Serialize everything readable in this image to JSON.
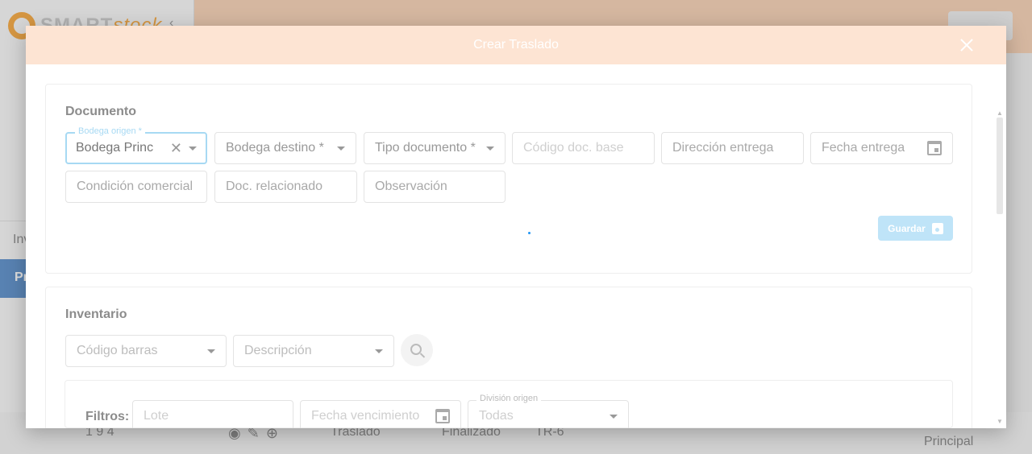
{
  "background": {
    "logo_text_a": "SMART",
    "logo_text_b": "stock",
    "sidebar_item_1": "Inv",
    "sidebar_item_2": "Pr",
    "row": {
      "col1": "1 9 4",
      "col2": "Traslado",
      "col3": "Finalizado",
      "col4": "TR-6",
      "col5": "—",
      "col6": "Principal"
    }
  },
  "modal": {
    "title": "Crear Traslado",
    "documento": {
      "title": "Documento",
      "bodega_origen": {
        "label": "Bodega origen *",
        "value": "Bodega Princ"
      },
      "bodega_destino": {
        "placeholder": "Bodega destino *"
      },
      "tipo_documento": {
        "placeholder": "Tipo documento *"
      },
      "codigo_doc_base": {
        "placeholder": "Código doc. base"
      },
      "direccion_entrega": {
        "placeholder": "Dirección entrega"
      },
      "fecha_entrega": {
        "placeholder": "Fecha entrega"
      },
      "condicion_comercial": {
        "placeholder": "Condición comercial"
      },
      "doc_relacionado": {
        "placeholder": "Doc. relacionado"
      },
      "observacion": {
        "placeholder": "Observación"
      },
      "save_label": "Guardar"
    },
    "inventario": {
      "title": "Inventario",
      "codigo_barras": {
        "placeholder": "Código barras"
      },
      "descripcion": {
        "placeholder": "Descripción"
      },
      "filters": {
        "label": "Filtros:",
        "lote": {
          "placeholder": "Lote"
        },
        "fecha_vencimiento": {
          "placeholder": "Fecha vencimiento"
        },
        "division_origen": {
          "label": "División origen",
          "value": "Todas"
        }
      }
    }
  },
  "colors": {
    "modal_header": "#fde4d3",
    "focus_accent": "#a7d9f3",
    "save_button": "#bfe4f8",
    "spinner": "#2196f3"
  }
}
